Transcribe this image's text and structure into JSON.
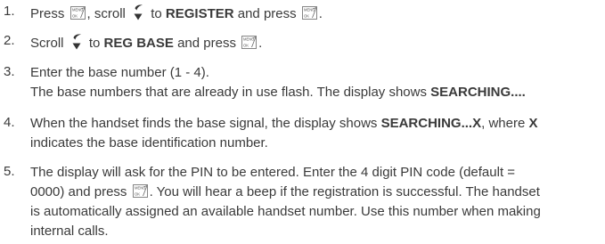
{
  "steps": [
    {
      "number": "1.",
      "t1": "Press",
      "t2": ", scroll",
      "t3": "to",
      "b1": "REGISTER",
      "t4": "and press",
      "t5": "."
    },
    {
      "number": "2.",
      "t1": "Scroll",
      "t2": "to",
      "b1": "REG BASE",
      "t3": "and press",
      "t4": "."
    },
    {
      "number": "3.",
      "line1": "Enter the base number (1 - 4).",
      "line2a": "The base numbers that are already in use flash. The display shows",
      "line2b": "SEARCHING...."
    },
    {
      "number": "4.",
      "line1a": "When the handset finds the base signal, the display shows",
      "line1b": "SEARCHING...X",
      "line1c": ", where",
      "line1d": "X",
      "line2": "indicates the base identification number."
    },
    {
      "number": "5.",
      "line1": "The display will ask for the PIN to be entered. Enter the 4 digit PIN code (default =",
      "line2a": "0000) and press",
      "line2b": ". You will hear a beep if the registration is successful. The handset",
      "line3": "is automatically assigned an available handset number. Use this number when making",
      "line4": "internal calls."
    }
  ],
  "icons": {
    "menu_ok_key": "menu-ok-key-icon",
    "scroll_key": "scroll-key-icon"
  }
}
